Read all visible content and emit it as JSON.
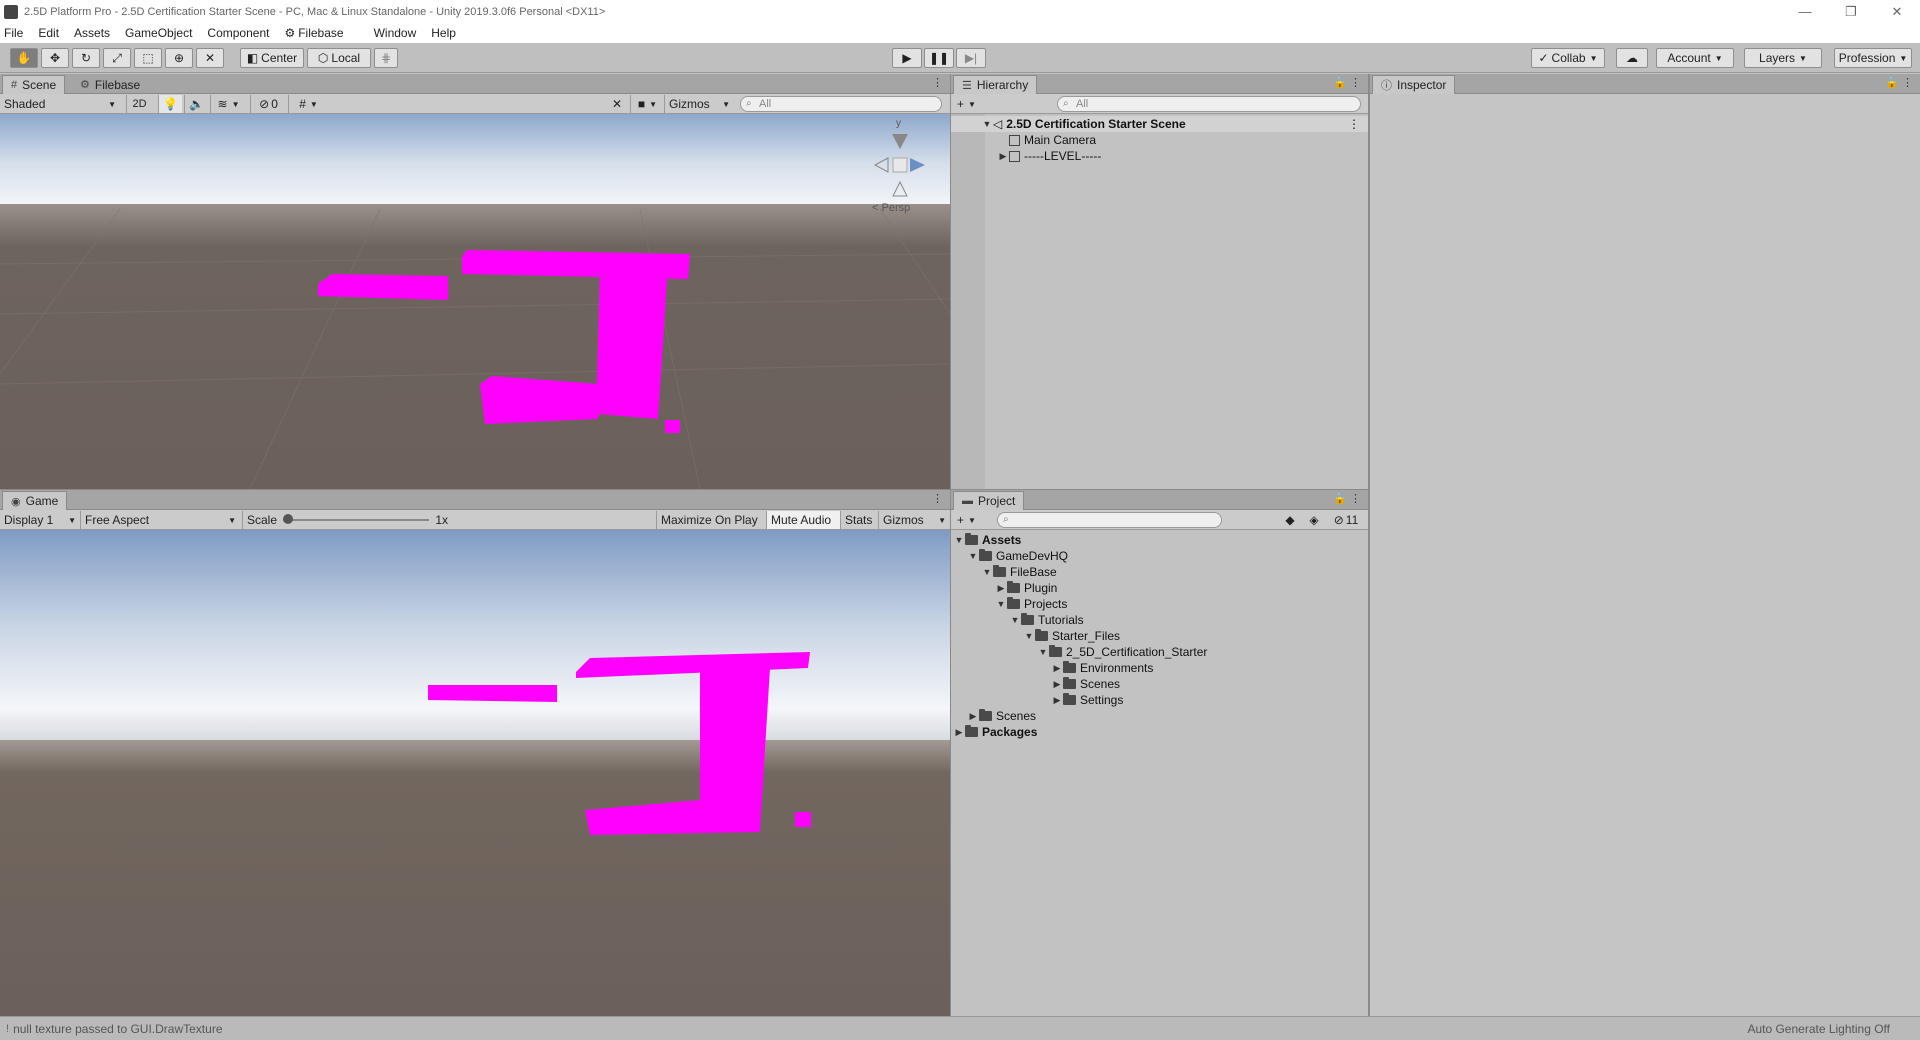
{
  "window": {
    "title": "2.5D Platform Pro - 2.5D Certification Starter Scene - PC, Mac & Linux Standalone - Unity 2019.3.0f6 Personal <DX11>",
    "controls": [
      "—",
      "❐",
      "✕"
    ]
  },
  "menu": [
    "File",
    "Edit",
    "Assets",
    "GameObject",
    "Component",
    "Filebase",
    "Window",
    "Help"
  ],
  "toolbar": {
    "pivot": "Center",
    "space": "Local",
    "collab": "Collab",
    "account": "Account",
    "layers": "Layers",
    "layout": "Profession"
  },
  "scene_panel": {
    "tabs": [
      "Scene",
      "Filebase"
    ],
    "shading": "Shaded",
    "mode_2d": "2D",
    "hidden_count": "0",
    "gizmos": "Gizmos",
    "search_placeholder": "All",
    "gizmo_axis": "y",
    "projection": "Persp"
  },
  "game_panel": {
    "tab": "Game",
    "display": "Display 1",
    "aspect": "Free Aspect",
    "scale_label": "Scale",
    "scale_value": 1,
    "scale_text": "1x",
    "maximize": "Maximize On Play",
    "mute": "Mute Audio",
    "stats": "Stats",
    "gizmos": "Gizmos"
  },
  "hierarchy": {
    "tab": "Hierarchy",
    "search_placeholder": "All",
    "scene_name": "2.5D Certification Starter Scene",
    "items": [
      "Main Camera",
      "-----LEVEL-----"
    ]
  },
  "project": {
    "tab": "Project",
    "hidden_count": "11",
    "tree": [
      {
        "label": "Assets",
        "bold": true
      },
      {
        "label": "GameDevHQ"
      },
      {
        "label": "FileBase"
      },
      {
        "label": "Plugin"
      },
      {
        "label": "Projects"
      },
      {
        "label": "Tutorials"
      },
      {
        "label": "Starter_Files"
      },
      {
        "label": "2_5D_Certification_Starter"
      },
      {
        "label": "Environments"
      },
      {
        "label": "Scenes"
      },
      {
        "label": "Settings"
      },
      {
        "label": "Scenes"
      },
      {
        "label": "Packages",
        "bold": true
      }
    ]
  },
  "inspector": {
    "tab": "Inspector"
  },
  "status": {
    "message": "null texture passed to GUI.DrawTexture",
    "right": "Auto Generate Lighting Off"
  },
  "colors": {
    "missing_material": "#ff00ff",
    "ground": "#6b605a",
    "sky_top": "#7f9bc4",
    "sky_horizon": "#f2f4f8"
  }
}
